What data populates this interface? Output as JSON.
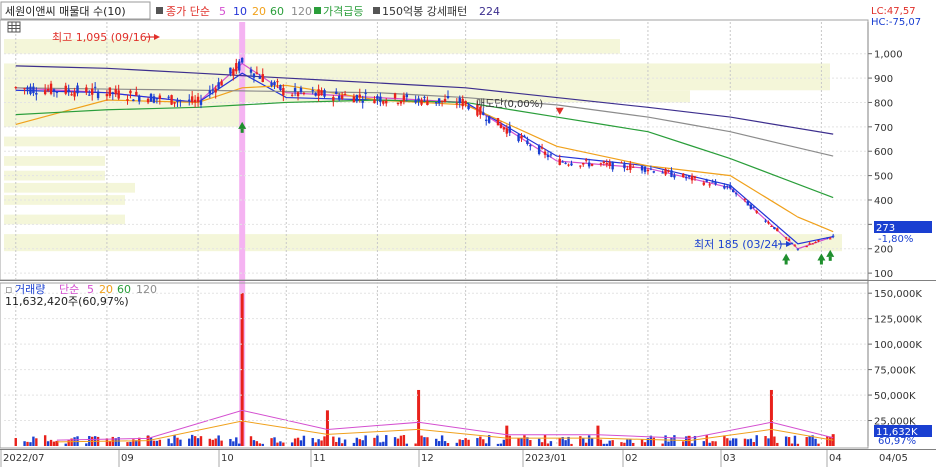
{
  "header": {
    "title": "세원이앤씨 매물대 수(10)",
    "legend_close": "종가 단순",
    "legend_ma_periods": [
      "5",
      "10",
      "20",
      "60",
      "120"
    ],
    "legend_surge": "가격급등",
    "legend_pattern": "150억봉 강세패턴",
    "legend_pattern_value": "224",
    "lc": "LC:47,57",
    "hc": "HC:-75,07"
  },
  "annotations": {
    "high": "최고 1,095 (09/16)",
    "low": "최저 185 (03/24)",
    "mid": "매도단(0,00%)"
  },
  "price_badge": "273",
  "price_change": "-1,80%",
  "volume": {
    "legend_label": "거래량",
    "legend_ma": "단순",
    "legend_periods": [
      "5",
      "20",
      "60",
      "120"
    ],
    "total": "11,632,420주(60,97%)",
    "badge": "11,632K",
    "badge_pct": "60,97%"
  },
  "date_labels": [
    "2022/07",
    "09",
    "10",
    "11",
    "12",
    "2023/01",
    "02",
    "03",
    "04",
    "04/05"
  ],
  "colors": {
    "up": "#e8211b",
    "down": "#1a3fd1",
    "ma5": "#d44fd0",
    "ma10": "#2434d8",
    "ma20": "#f0a11c",
    "ma60": "#2a9e3a",
    "ma120": "#8c8c8c",
    "ma224": "#3d2f8e",
    "volume_profile": "#f4f6d9",
    "highlight": "#f5b3f2"
  },
  "chart_data": [
    {
      "type": "line",
      "title": "세원이앤씨 매물대 수(10)",
      "ylim": [
        80,
        1130
      ],
      "y_ticks": [
        100,
        200,
        300,
        400,
        500,
        600,
        700,
        800,
        900,
        1000
      ],
      "series": [
        {
          "name": "5",
          "x": [
            "2022-07-01",
            "2022-08-01",
            "2022-09-01",
            "2022-09-16",
            "2022-10-01",
            "2022-11-01",
            "2022-12-01",
            "2023-01-01",
            "2023-02-01",
            "2023-03-01",
            "2023-03-24",
            "2023-04-05"
          ],
          "values": [
            860,
            840,
            800,
            960,
            840,
            820,
            800,
            560,
            530,
            450,
            200,
            250
          ]
        },
        {
          "name": "10",
          "x": [
            "2022-07-01",
            "2022-08-01",
            "2022-09-01",
            "2022-09-16",
            "2022-10-01",
            "2022-11-01",
            "2022-12-01",
            "2023-01-01",
            "2023-02-01",
            "2023-03-01",
            "2023-03-24",
            "2023-04-05"
          ],
          "values": [
            850,
            840,
            800,
            920,
            820,
            810,
            800,
            580,
            540,
            460,
            220,
            250
          ]
        },
        {
          "name": "20",
          "x": [
            "2022-07-01",
            "2022-08-01",
            "2022-09-01",
            "2022-09-16",
            "2022-10-01",
            "2022-11-01",
            "2022-12-01",
            "2023-01-01",
            "2023-02-01",
            "2023-03-01",
            "2023-03-24",
            "2023-04-05"
          ],
          "values": [
            710,
            810,
            800,
            860,
            870,
            810,
            790,
            620,
            540,
            500,
            330,
            270
          ]
        },
        {
          "name": "60",
          "x": [
            "2022-07-01",
            "2022-08-01",
            "2022-09-01",
            "2022-10-01",
            "2022-11-01",
            "2022-12-01",
            "2023-01-01",
            "2023-02-01",
            "2023-03-01",
            "2023-04-05"
          ],
          "values": [
            750,
            770,
            780,
            800,
            810,
            800,
            740,
            680,
            570,
            410
          ]
        },
        {
          "name": "120",
          "x": [
            "2022-07-01",
            "2022-08-01",
            "2022-09-01",
            "2022-10-01",
            "2022-11-01",
            "2022-12-01",
            "2023-01-01",
            "2023-02-01",
            "2023-03-01",
            "2023-04-05"
          ],
          "values": [
            860,
            855,
            850,
            845,
            840,
            820,
            790,
            740,
            680,
            580
          ]
        },
        {
          "name": "224",
          "x": [
            "2022-07-01",
            "2022-08-01",
            "2022-09-01",
            "2022-10-01",
            "2022-11-01",
            "2022-12-01",
            "2023-01-01",
            "2023-02-01",
            "2023-03-01",
            "2023-04-05"
          ],
          "values": [
            950,
            940,
            920,
            900,
            880,
            860,
            820,
            780,
            740,
            670
          ]
        }
      ]
    },
    {
      "type": "bar",
      "title": "거래량",
      "ylim": [
        0,
        160000
      ],
      "y_ticks": [
        "25,000K",
        "50,000K",
        "75,000K",
        "100,000K",
        "125,000K",
        "150,000K"
      ],
      "categories": [
        "2022-07",
        "2022-08",
        "2022-09-16",
        "2022-10",
        "2022-11",
        "2022-12",
        "2023-01",
        "2023-02",
        "2023-03",
        "2023-04-05"
      ],
      "values": [
        5000,
        10000,
        150000,
        35000,
        55000,
        20000,
        20000,
        10000,
        55000,
        11632
      ]
    }
  ]
}
